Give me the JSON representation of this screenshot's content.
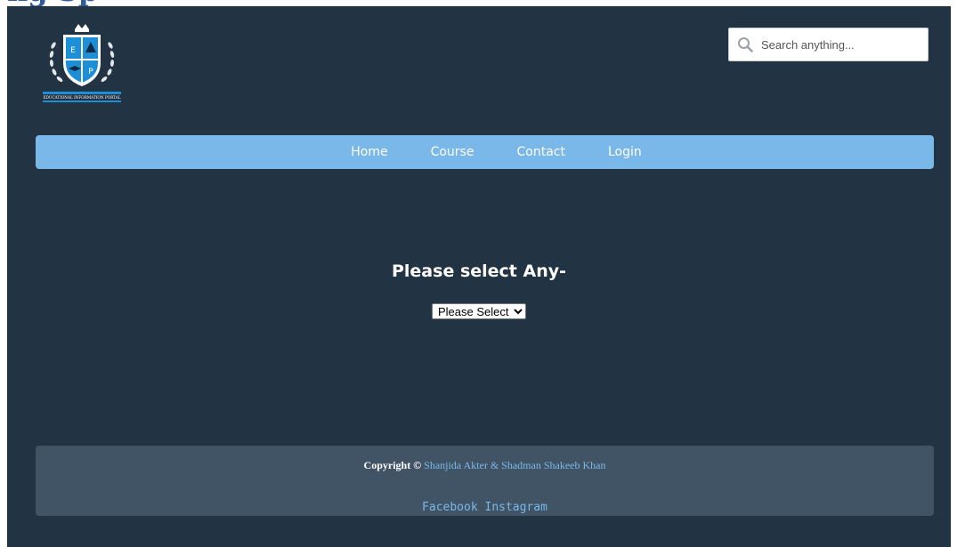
{
  "header": {
    "logo_icon": "school-crest-logo-icon",
    "logo_caption": "EDUCATIONAL INFORMATION PORTAL",
    "search": {
      "placeholder": "Search anything...",
      "icon": "search-icon"
    }
  },
  "nav": {
    "items": [
      {
        "label": "Home"
      },
      {
        "label": "Course"
      },
      {
        "label": "Contact"
      },
      {
        "label": "Login"
      }
    ]
  },
  "main": {
    "title": "Please select Any-",
    "select": {
      "selected": "Please Select"
    }
  },
  "footer": {
    "copyright_prefix": "Copyright ©",
    "authors": "Shanjida Akter & Shadman Shakeeb Khan",
    "links": [
      {
        "label": "Facebook"
      },
      {
        "label": "Instagram"
      }
    ]
  },
  "colors": {
    "page_background": "#223344",
    "navbar": "#7ab8e9",
    "footer": "#415466",
    "link": "#7ab8e9"
  }
}
